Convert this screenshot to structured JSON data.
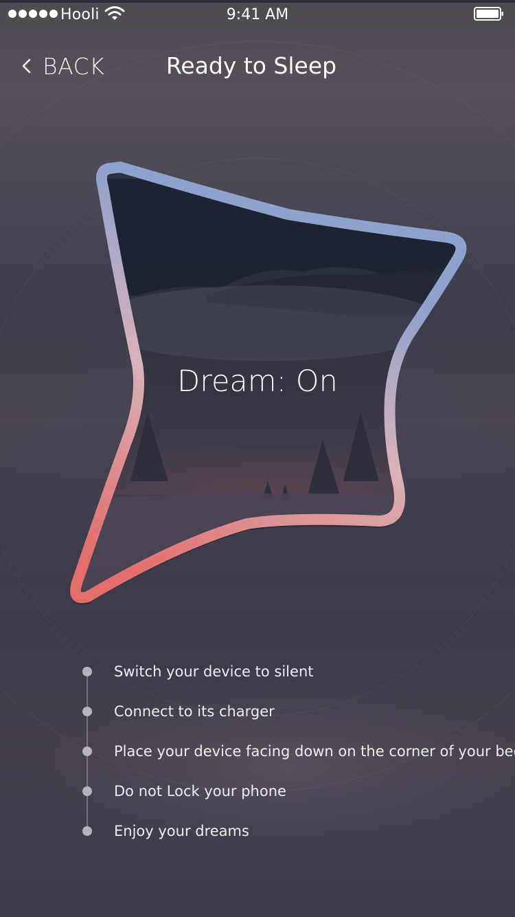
{
  "status_bar": {
    "carrier": "Hooli",
    "time": "9:41 AM",
    "signal_icon": "signal-dots-icon",
    "wifi_icon": "wifi-icon",
    "battery_icon": "battery-icon",
    "battery_level": 1.0
  },
  "nav": {
    "back_label": "BACK",
    "back_icon": "chevron-left-icon",
    "title": "Ready to Sleep"
  },
  "dream": {
    "label": "Dream: On",
    "gradient_colors": [
      "#8fa2cc",
      "#d8b2b9",
      "#e26d6a"
    ]
  },
  "checklist": {
    "items": [
      "Switch your device to silent",
      "Connect to its charger",
      "Place your device facing down on the corner of your bed",
      "Do not Lock your phone",
      "Enjoy your dreams"
    ]
  }
}
